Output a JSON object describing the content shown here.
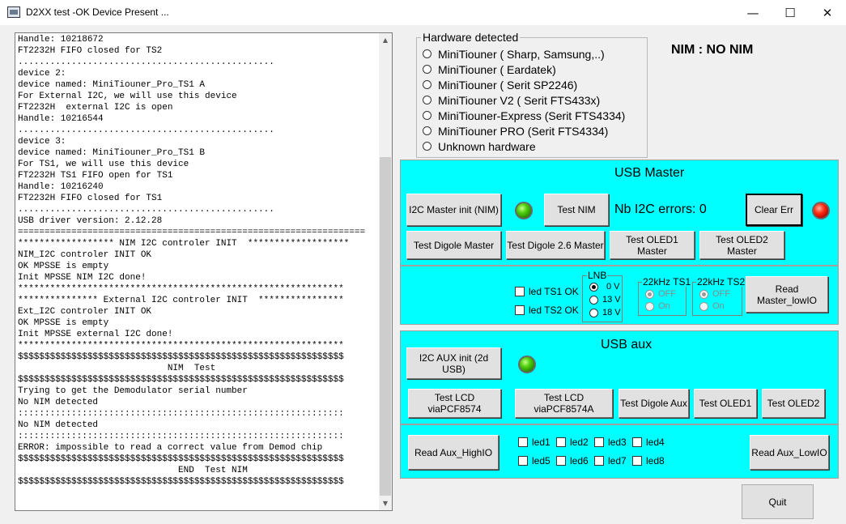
{
  "window": {
    "title": "D2XX test -OK Device Present ...",
    "minimize": "—",
    "maximize": "☐",
    "close": "✕"
  },
  "log": {
    "text": "Handle: 10218672\nFT2232H FIFO closed for TS2\n................................................\ndevice 2:\ndevice named: MiniTiouner_Pro_TS1 A\nFor External I2C, we will use this device\nFT2232H  external I2C is open\nHandle: 10216544\n................................................\ndevice 3:\ndevice named: MiniTiouner_Pro_TS1 B\nFor TS1, we will use this device\nFT2232H TS1 FIFO open for TS1\nHandle: 10216240\nFT2232H FIFO closed for TS1\n................................................\nUSB driver version: 2.12.28\n=================================================================\n****************** NIM I2C controler INIT  *******************\nNIM_I2C controler INIT OK\nOK MPSSE is empty\nInit MPSSE NIM I2C done!\n*************************************************************\n*************** External I2C controler INIT  ****************\nExt_I2C controler INIT OK\nOK MPSSE is empty\nInit MPSSE external I2C done!\n*************************************************************\n$$$$$$$$$$$$$$$$$$$$$$$$$$$$$$$$$$$$$$$$$$$$$$$$$$$$$$$$$$$$$\n                            NIM  Test\n$$$$$$$$$$$$$$$$$$$$$$$$$$$$$$$$$$$$$$$$$$$$$$$$$$$$$$$$$$$$$\nTrying to get the Demodulator serial number\nNo NIM detected\n:::::::::::::::::::::::::::::::::::::::::::::::::::::::::::::\nNo NIM detected\n:::::::::::::::::::::::::::::::::::::::::::::::::::::::::::::\nERROR: impossible to read a correct value from Demod chip\n$$$$$$$$$$$$$$$$$$$$$$$$$$$$$$$$$$$$$$$$$$$$$$$$$$$$$$$$$$$$$\n                              END  Test NIM\n$$$$$$$$$$$$$$$$$$$$$$$$$$$$$$$$$$$$$$$$$$$$$$$$$$$$$$$$$$$$$",
    "scroll_up": "▲",
    "scroll_down": "▼"
  },
  "hardware": {
    "title": "Hardware detected",
    "options": [
      "MiniTiouner ( Sharp, Samsung,..)",
      "MiniTiouner ( Eardatek)",
      "MiniTiouner ( Serit SP2246)",
      "MiniTiouner V2 ( Serit FTS433x)",
      "MiniTiouner-Express (Serit FTS4334)",
      "MiniTiouner PRO  (Serit FTS4334)",
      "Unknown hardware"
    ]
  },
  "nim_status": "NIM : NO NIM",
  "usb_master": {
    "title": "USB Master",
    "i2c_init": "I2C Master init (NIM)",
    "test_nim": "Test NIM",
    "errors_label": "Nb I2C errors:",
    "errors_value": "0",
    "clear_err": "Clear Err",
    "test_digole": "Test Digole Master",
    "test_digole26": "Test Digole 2.6 Master",
    "test_oled1": "Test OLED1 Master",
    "test_oled2": "Test OLED2 Master",
    "led_ts1": "led TS1 OK",
    "led_ts2": "led TS2 OK",
    "lnb_title": "LNB",
    "lnb_options": [
      "0 V",
      "13 V",
      "18 V"
    ],
    "ts1_title": "22kHz TS1",
    "ts2_title": "22kHz TS2",
    "off_label": "OFF",
    "on_label": "On",
    "read_master_low": "Read Master_lowIO",
    "led_master_on": 1,
    "led_error_on": 1
  },
  "usb_aux": {
    "title": "USB aux",
    "i2c_aux_init": "I2C AUX init (2d USB)",
    "test_lcd1": "Test LCD viaPCF8574",
    "test_lcd2": "Test LCD viaPCF8574A",
    "test_digole_aux": "Test Digole Aux",
    "test_oled1": "Test OLED1",
    "test_oled2": "Test OLED2",
    "read_aux_high": "Read Aux_HighIO",
    "read_aux_low": "Read Aux_LowIO",
    "leds": [
      "led1",
      "led2",
      "led3",
      "led4",
      "led5",
      "led6",
      "led7",
      "led8"
    ],
    "led_aux_on": 1
  },
  "quit": "Quit",
  "colors": {
    "panel": "#00ffff",
    "led_green": "#50d010",
    "led_red": "#ff2a10"
  }
}
